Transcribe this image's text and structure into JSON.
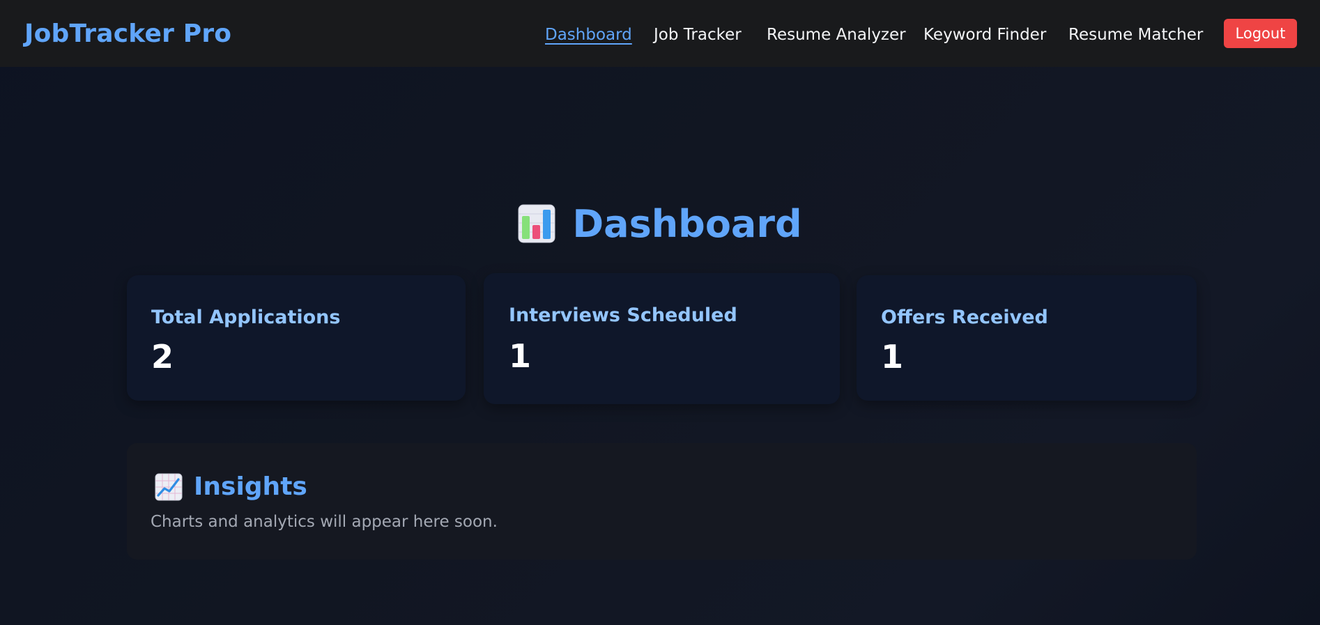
{
  "app": {
    "brand": "JobTracker Pro"
  },
  "nav": {
    "links": [
      "Dashboard",
      "Job Tracker",
      "Resume Analyzer",
      "Keyword Finder",
      "Resume Matcher"
    ],
    "active_index": 0,
    "logout_label": "Logout"
  },
  "page": {
    "title": "Dashboard",
    "title_icon": "bar-chart-icon"
  },
  "stats": [
    {
      "label": "Total Applications",
      "value": "2"
    },
    {
      "label": "Interviews Scheduled",
      "value": "1"
    },
    {
      "label": "Offers Received",
      "value": "1"
    }
  ],
  "insights": {
    "icon": "trend-chart-icon",
    "title": "Insights",
    "text": "Charts and analytics will appear here soon."
  },
  "colors": {
    "accent": "#60a5fa",
    "logout": "#ef4444",
    "card_bg": "#0f172a",
    "nav_bg": "#191a1c"
  }
}
